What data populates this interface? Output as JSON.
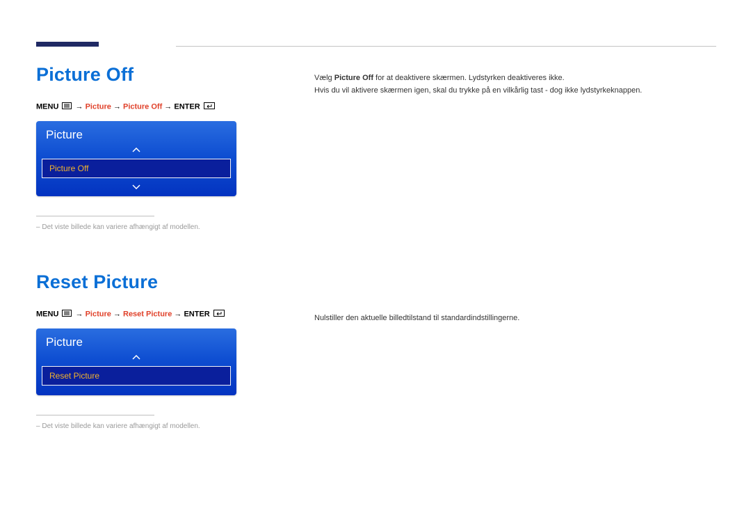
{
  "section1": {
    "title": "Picture Off",
    "breadcrumb": {
      "menu": "MENU",
      "p1": "Picture",
      "p2": "Picture Off",
      "enter": "ENTER"
    },
    "osd": {
      "title": "Picture",
      "item": "Picture Off"
    },
    "footnote": "Det viste billede kan variere afhængigt af modellen.",
    "desc_pre": "Vælg ",
    "desc_bold": "Picture Off",
    "desc_post": " for at deaktivere skærmen. Lydstyrken deaktiveres ikke.",
    "desc2": "Hvis du vil aktivere skærmen igen, skal du trykke på en vilkårlig tast - dog ikke lydstyrkeknappen."
  },
  "section2": {
    "title": "Reset Picture",
    "breadcrumb": {
      "menu": "MENU",
      "p1": "Picture",
      "p2": "Reset Picture",
      "enter": "ENTER"
    },
    "osd": {
      "title": "Picture",
      "item": "Reset Picture"
    },
    "footnote": "Det viste billede kan variere afhængigt af modellen.",
    "desc": "Nulstiller den aktuelle billedtilstand til standardindstillingerne."
  }
}
